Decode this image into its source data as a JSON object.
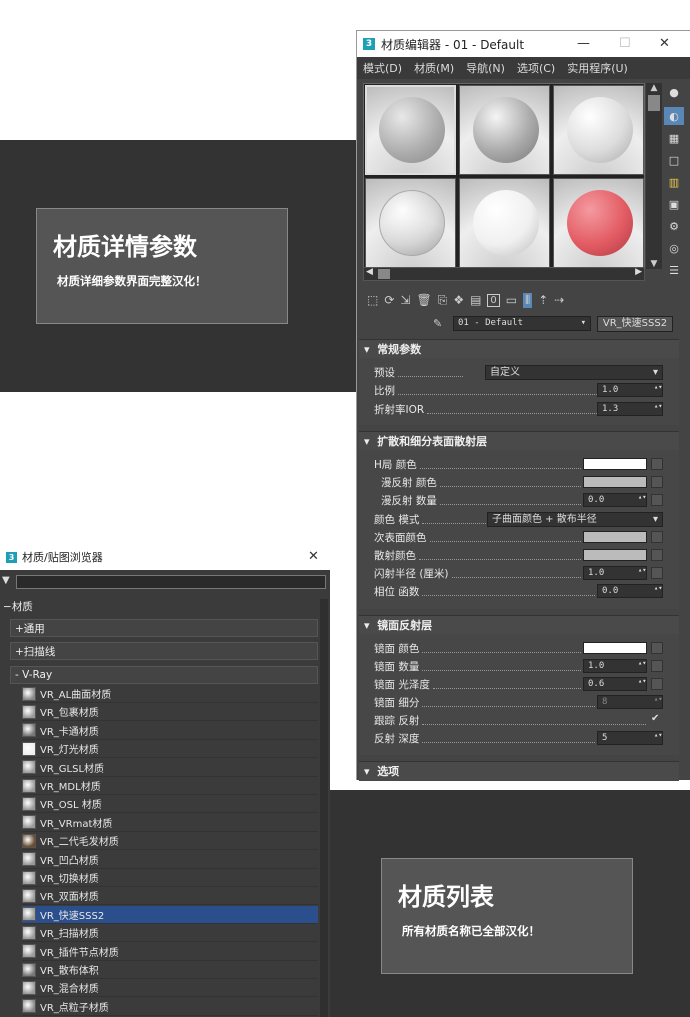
{
  "card1": {
    "title": "材质详情参数",
    "subtitle": "材质详细参数界面完整汉化！"
  },
  "card2": {
    "title": "材质列表",
    "subtitle": "所有材质名称已全部汉化！"
  },
  "editor": {
    "title": "材质编辑器 - 01 - Default",
    "menu": [
      "模式(D)",
      "材质(M)",
      "导航(N)",
      "选项(C)",
      "实用程序(U)"
    ],
    "material_name": "01 - Default",
    "material_type": "VR_快速SSS2",
    "rollouts": {
      "general": {
        "title": "常规参数",
        "preset_label": "预设",
        "preset_value": "自定义",
        "scale_label": "比例",
        "scale_value": "1.0",
        "ior_label": "折射率IOR",
        "ior_value": "1.3"
      },
      "sss": {
        "title": "扩散和细分表面散射层",
        "overall_color": "H局 颜色",
        "diffuse_color": "漫反射 颜色",
        "diffuse_amount": "漫反射 数量",
        "diffuse_amount_value": "0.0",
        "color_mode": "颜色 模式",
        "color_mode_value": "子曲面颜色 + 散布半径",
        "sub_color": "次表面颜色",
        "scatter_color": "散射颜色",
        "radius": "闪射半径 (厘米)",
        "radius_value": "1.0",
        "phase": "相位 函数",
        "phase_value": "0.0"
      },
      "spec": {
        "title": "镜面反射层",
        "spec_color": "镜面 颜色",
        "spec_amount": "镜面 数量",
        "spec_amount_value": "1.0",
        "spec_gloss": "镜面 光泽度",
        "spec_gloss_value": "0.6",
        "spec_subdivs": "镜面 细分",
        "spec_subdivs_value": "8",
        "trace": "跟踪 反射",
        "depth": "反射 深度",
        "depth_value": "5"
      },
      "options": {
        "title": "选项"
      }
    }
  },
  "browser": {
    "title": "材质/贴图浏览器",
    "root": "材质",
    "groups": [
      "+通用",
      "+扫描线",
      "- V-Ray"
    ],
    "items": [
      "VR_AL曲面材质",
      "VR_包裹材质",
      "VR_卡通材质",
      "VR_灯光材质",
      "VR_GLSL材质",
      "VR_MDL材质",
      "VR_OSL 材质",
      "VR_VRmat材质",
      "VR_二代毛发材质",
      "VR_凹凸材质",
      "VR_切换材质",
      "VR_双面材质",
      "VR_快速SSS2",
      "VR_扫描材质",
      "VR_插件节点材质",
      "VR_散布体积",
      "VR_混合材质",
      "VR_点粒子材质"
    ]
  },
  "colors": {
    "band": "#333333",
    "card": "#555555",
    "selected": "#2a4f8c",
    "swatch_red": "#e35c64"
  }
}
